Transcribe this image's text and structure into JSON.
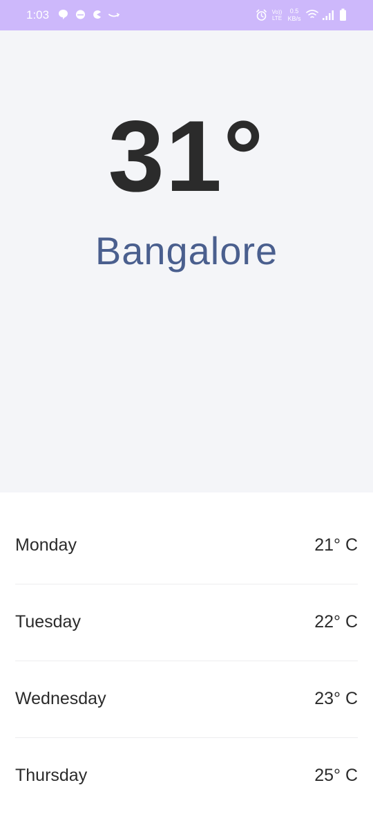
{
  "status_bar": {
    "time": "1:03",
    "network_speed_value": "0.5",
    "network_speed_unit": "KB/s",
    "volte_top": "Vo))",
    "volte_bottom": "LTE",
    "background_color": "#cdb8fb"
  },
  "weather": {
    "current_temp": "31°",
    "city": "Bangalore"
  },
  "forecast": [
    {
      "day": "Monday",
      "temp": "21° C"
    },
    {
      "day": "Tuesday",
      "temp": "22° C"
    },
    {
      "day": "Wednesday",
      "temp": "23° C"
    },
    {
      "day": "Thursday",
      "temp": "25° C"
    }
  ],
  "icons": [
    "chat-icon",
    "messenger-icon",
    "pacman-icon",
    "amazon-icon",
    "alarm-icon",
    "wifi-icon",
    "signal-icon",
    "battery-icon"
  ]
}
